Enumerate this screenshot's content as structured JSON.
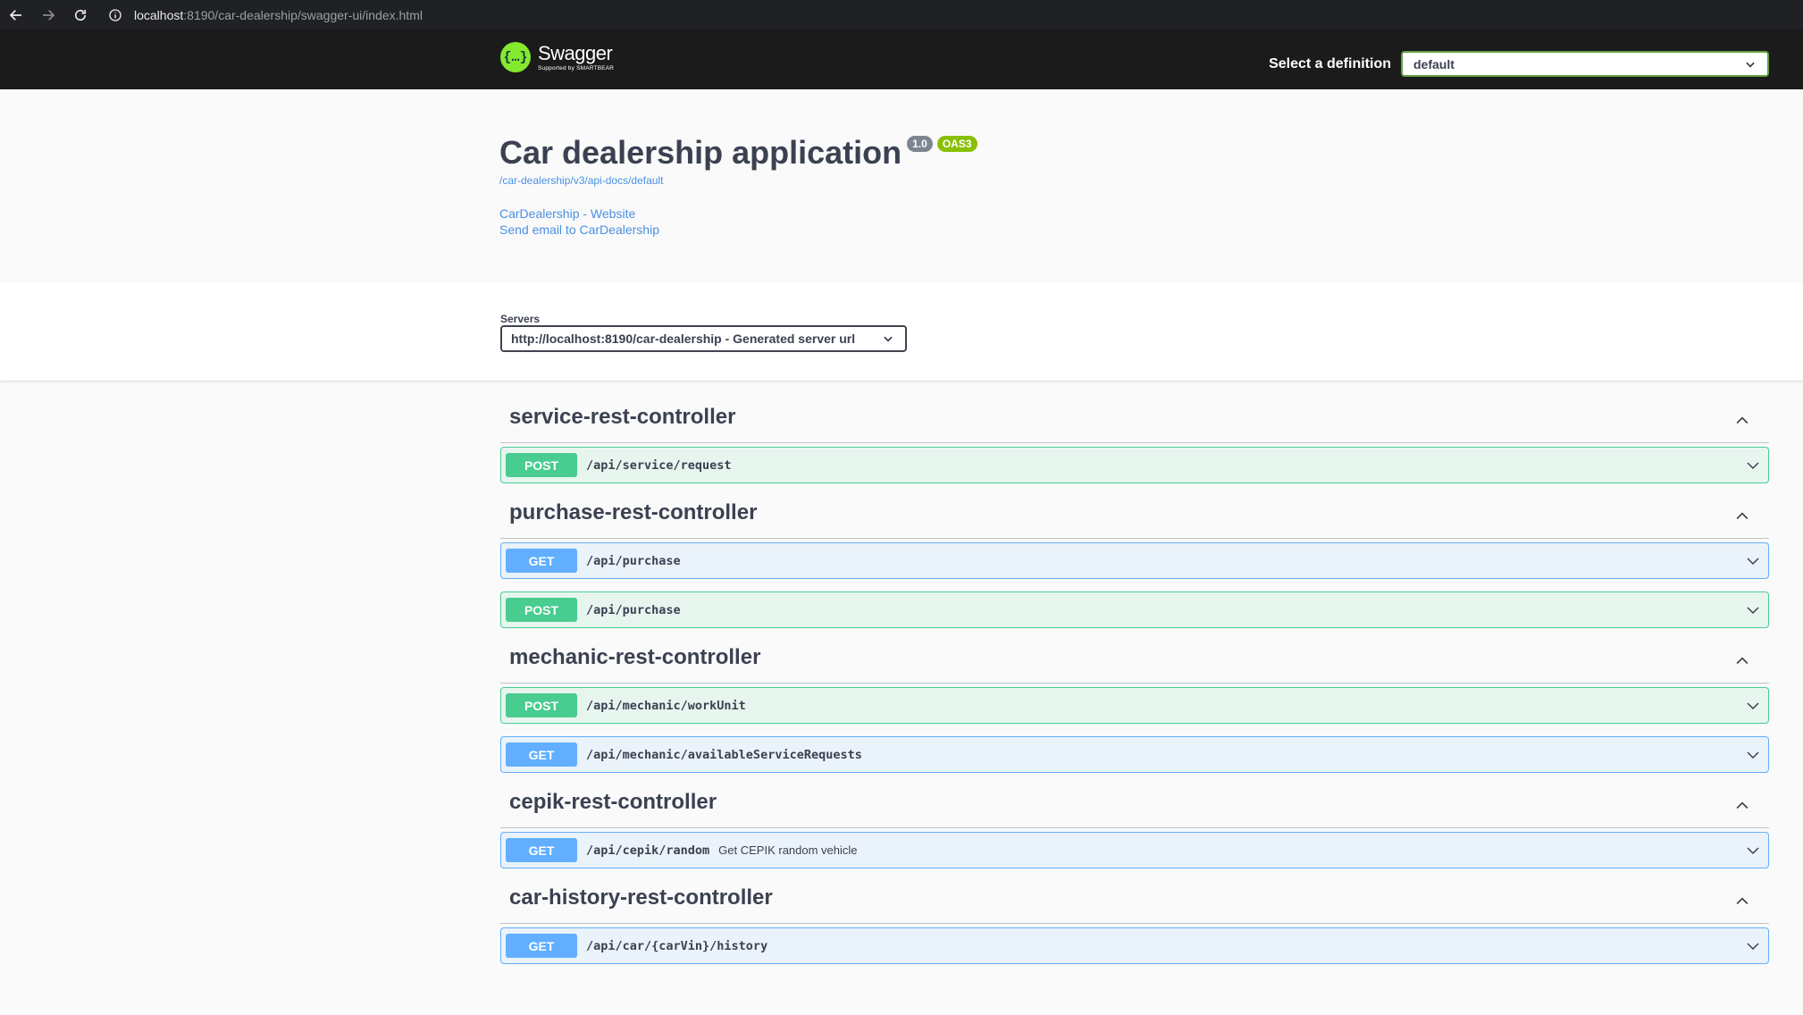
{
  "browser": {
    "url_host": "localhost",
    "url_path": ":8190/car-dealership/swagger-ui/index.html"
  },
  "topbar": {
    "logo_word": "Swagger",
    "logo_sub": "Supported by SMARTBEAR",
    "definition_label": "Select a definition",
    "definition_value": "default"
  },
  "info": {
    "title": "Car dealership application",
    "version": "1.0",
    "oas": "OAS3",
    "spec_url": "/car-dealership/v3/api-docs/default",
    "website_link": "CarDealership - Website",
    "email_link": "Send email to CarDealership"
  },
  "servers": {
    "label": "Servers",
    "selected": "http://localhost:8190/car-dealership - Generated server url"
  },
  "tags": [
    {
      "name": "service-rest-controller",
      "operations": [
        {
          "method": "POST",
          "path": "/api/service/request",
          "summary": ""
        }
      ]
    },
    {
      "name": "purchase-rest-controller",
      "operations": [
        {
          "method": "GET",
          "path": "/api/purchase",
          "summary": ""
        },
        {
          "method": "POST",
          "path": "/api/purchase",
          "summary": ""
        }
      ]
    },
    {
      "name": "mechanic-rest-controller",
      "operations": [
        {
          "method": "POST",
          "path": "/api/mechanic/workUnit",
          "summary": ""
        },
        {
          "method": "GET",
          "path": "/api/mechanic/availableServiceRequests",
          "summary": ""
        }
      ]
    },
    {
      "name": "cepik-rest-controller",
      "operations": [
        {
          "method": "GET",
          "path": "/api/cepik/random",
          "summary": "Get CEPIK random vehicle"
        }
      ]
    },
    {
      "name": "car-history-rest-controller",
      "operations": [
        {
          "method": "GET",
          "path": "/api/car/{carVin}/history",
          "summary": ""
        }
      ]
    }
  ],
  "colors": {
    "post": "#49cc90",
    "get": "#61affe",
    "topbar_bg": "#1b1b1b",
    "link": "#4990e2"
  }
}
